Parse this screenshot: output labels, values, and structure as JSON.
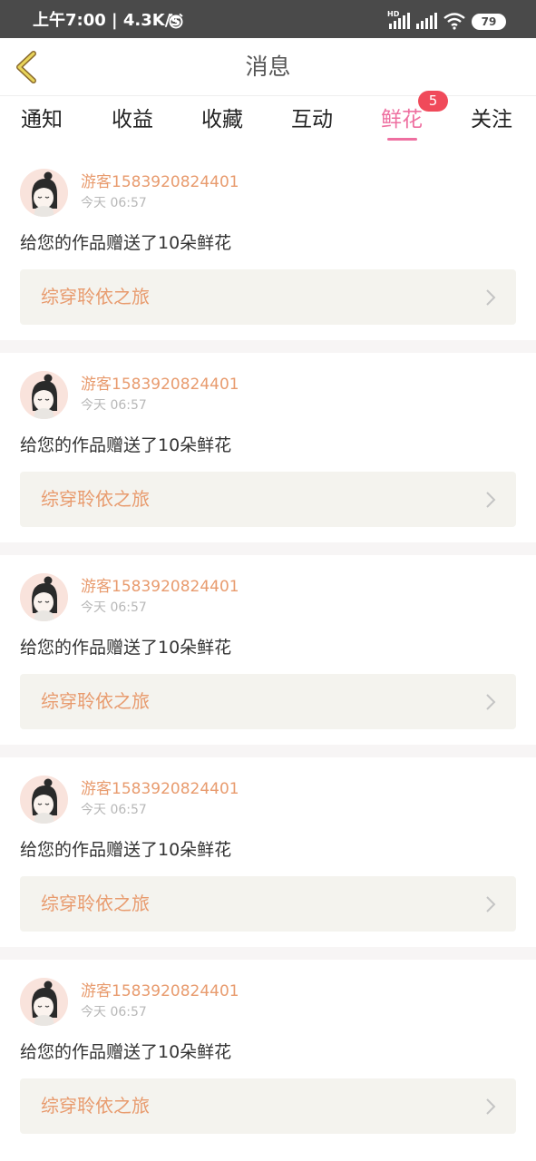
{
  "status_bar": {
    "time": "上午7:00 | 4.3K/s",
    "network_label": "HD",
    "battery": "79",
    "icons": [
      "alarm-icon",
      "signal-icon",
      "signal-icon",
      "wifi-icon",
      "battery-icon"
    ]
  },
  "header": {
    "back_icon": "chevron-left-icon",
    "title": "消息"
  },
  "tabs": [
    {
      "label": "通知",
      "active": false
    },
    {
      "label": "收益",
      "active": false
    },
    {
      "label": "收藏",
      "active": false
    },
    {
      "label": "互动",
      "active": false
    },
    {
      "label": "鲜花",
      "active": true,
      "badge": "5"
    },
    {
      "label": "关注",
      "active": false
    }
  ],
  "colors": {
    "accent": "#ee6fa0",
    "badge": "#f04a5a",
    "username": "#e89b6e",
    "link_bg": "#f4f3ee"
  },
  "notifications": [
    {
      "user": "游客1583920824401",
      "time": "今天 06:57",
      "message": "给您的作品赠送了10朵鲜花",
      "work": "综穿聆依之旅"
    },
    {
      "user": "游客1583920824401",
      "time": "今天 06:57",
      "message": "给您的作品赠送了10朵鲜花",
      "work": "综穿聆依之旅"
    },
    {
      "user": "游客1583920824401",
      "time": "今天 06:57",
      "message": "给您的作品赠送了10朵鲜花",
      "work": "综穿聆依之旅"
    },
    {
      "user": "游客1583920824401",
      "time": "今天 06:57",
      "message": "给您的作品赠送了10朵鲜花",
      "work": "综穿聆依之旅"
    },
    {
      "user": "游客1583920824401",
      "time": "今天 06:57",
      "message": "给您的作品赠送了10朵鲜花",
      "work": "综穿聆依之旅"
    }
  ]
}
